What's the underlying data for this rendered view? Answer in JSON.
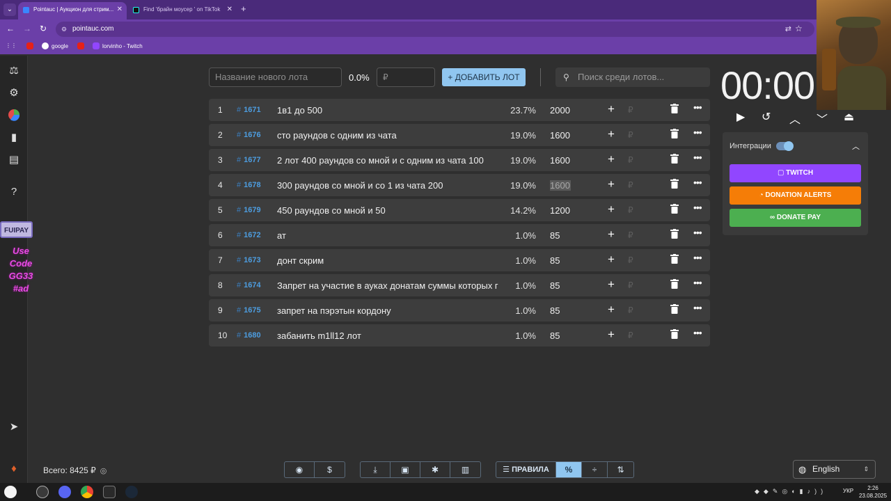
{
  "browser": {
    "tabs": [
      {
        "title": "Pointauc | Аукцион для стрим...",
        "active": true
      },
      {
        "title": "Find 'брайн моусер ' on TikTok",
        "active": false
      }
    ],
    "url": "pointauc.com",
    "bookmarks": [
      "google",
      "lorvinho - Twitch"
    ]
  },
  "sidebar": {
    "icons": [
      "gavel-icon",
      "gear-icon",
      "pie-chart-icon",
      "bar-chart-icon",
      "clipboard-icon",
      "help-icon",
      "telegram-icon"
    ],
    "promo_badge": "FUIPAY",
    "promo_text": [
      "Use Code",
      "GG33",
      "#ad"
    ]
  },
  "controls": {
    "lot_name_placeholder": "Название нового лота",
    "percent": "0.0%",
    "amount_placeholder": "₽",
    "add_button": "ДОБАВИТЬ ЛОТ",
    "search_placeholder": "Поиск среди лотов..."
  },
  "lots": [
    {
      "n": "1",
      "id": "1671",
      "name": "1в1 до 500",
      "percent": "23.7%",
      "amount": "2000",
      "highlight": false
    },
    {
      "n": "2",
      "id": "1676",
      "name": "сто раундов с одним из чата",
      "percent": "19.0%",
      "amount": "1600",
      "highlight": false
    },
    {
      "n": "3",
      "id": "1677",
      "name": " 2 лот 400 раундов со мной и с одним из чата 100",
      "percent": "19.0%",
      "amount": "1600",
      "highlight": false
    },
    {
      "n": "4",
      "id": "1678",
      "name": " 300 раундов со мной и со 1 из чата 200",
      "percent": "19.0%",
      "amount": "1600",
      "highlight": true
    },
    {
      "n": "5",
      "id": "1679",
      "name": "450 раундов со мной и 50",
      "percent": "14.2%",
      "amount": "1200",
      "highlight": false
    },
    {
      "n": "6",
      "id": "1672",
      "name": " ат",
      "percent": "1.0%",
      "amount": "85",
      "highlight": false
    },
    {
      "n": "7",
      "id": "1673",
      "name": "донт скрим",
      "percent": "1.0%",
      "amount": "85",
      "highlight": false
    },
    {
      "n": "8",
      "id": "1674",
      "name": "Запрет на участие в ауках донатам суммы которых г",
      "percent": "1.0%",
      "amount": "85",
      "highlight": false
    },
    {
      "n": "9",
      "id": "1675",
      "name": "запрет на пэрэтын кордону",
      "percent": "1.0%",
      "amount": "85",
      "highlight": false
    },
    {
      "n": "10",
      "id": "1680",
      "name": "забанить m1ll12 лот",
      "percent": "1.0%",
      "amount": "85",
      "highlight": false
    }
  ],
  "row_symbols": {
    "hash": "#",
    "plus": "+",
    "rub": "₽",
    "dots": "•••"
  },
  "timer": {
    "display": "00:00"
  },
  "integrations": {
    "title": "Интеграции",
    "enabled": true,
    "buttons": [
      {
        "label": "TWITCH",
        "color": "#9146ff"
      },
      {
        "label": "DONATION ALERTS",
        "color": "#f57d07"
      },
      {
        "label": "DONATE PAY",
        "color": "#4caf50"
      }
    ]
  },
  "footer": {
    "total": "Всего: 8425 ₽",
    "rules_label": "ПРАВИЛА",
    "language": "English"
  },
  "system": {
    "keyboard_layout": "УКР",
    "time": "2:26",
    "date": "23.08.2025"
  }
}
